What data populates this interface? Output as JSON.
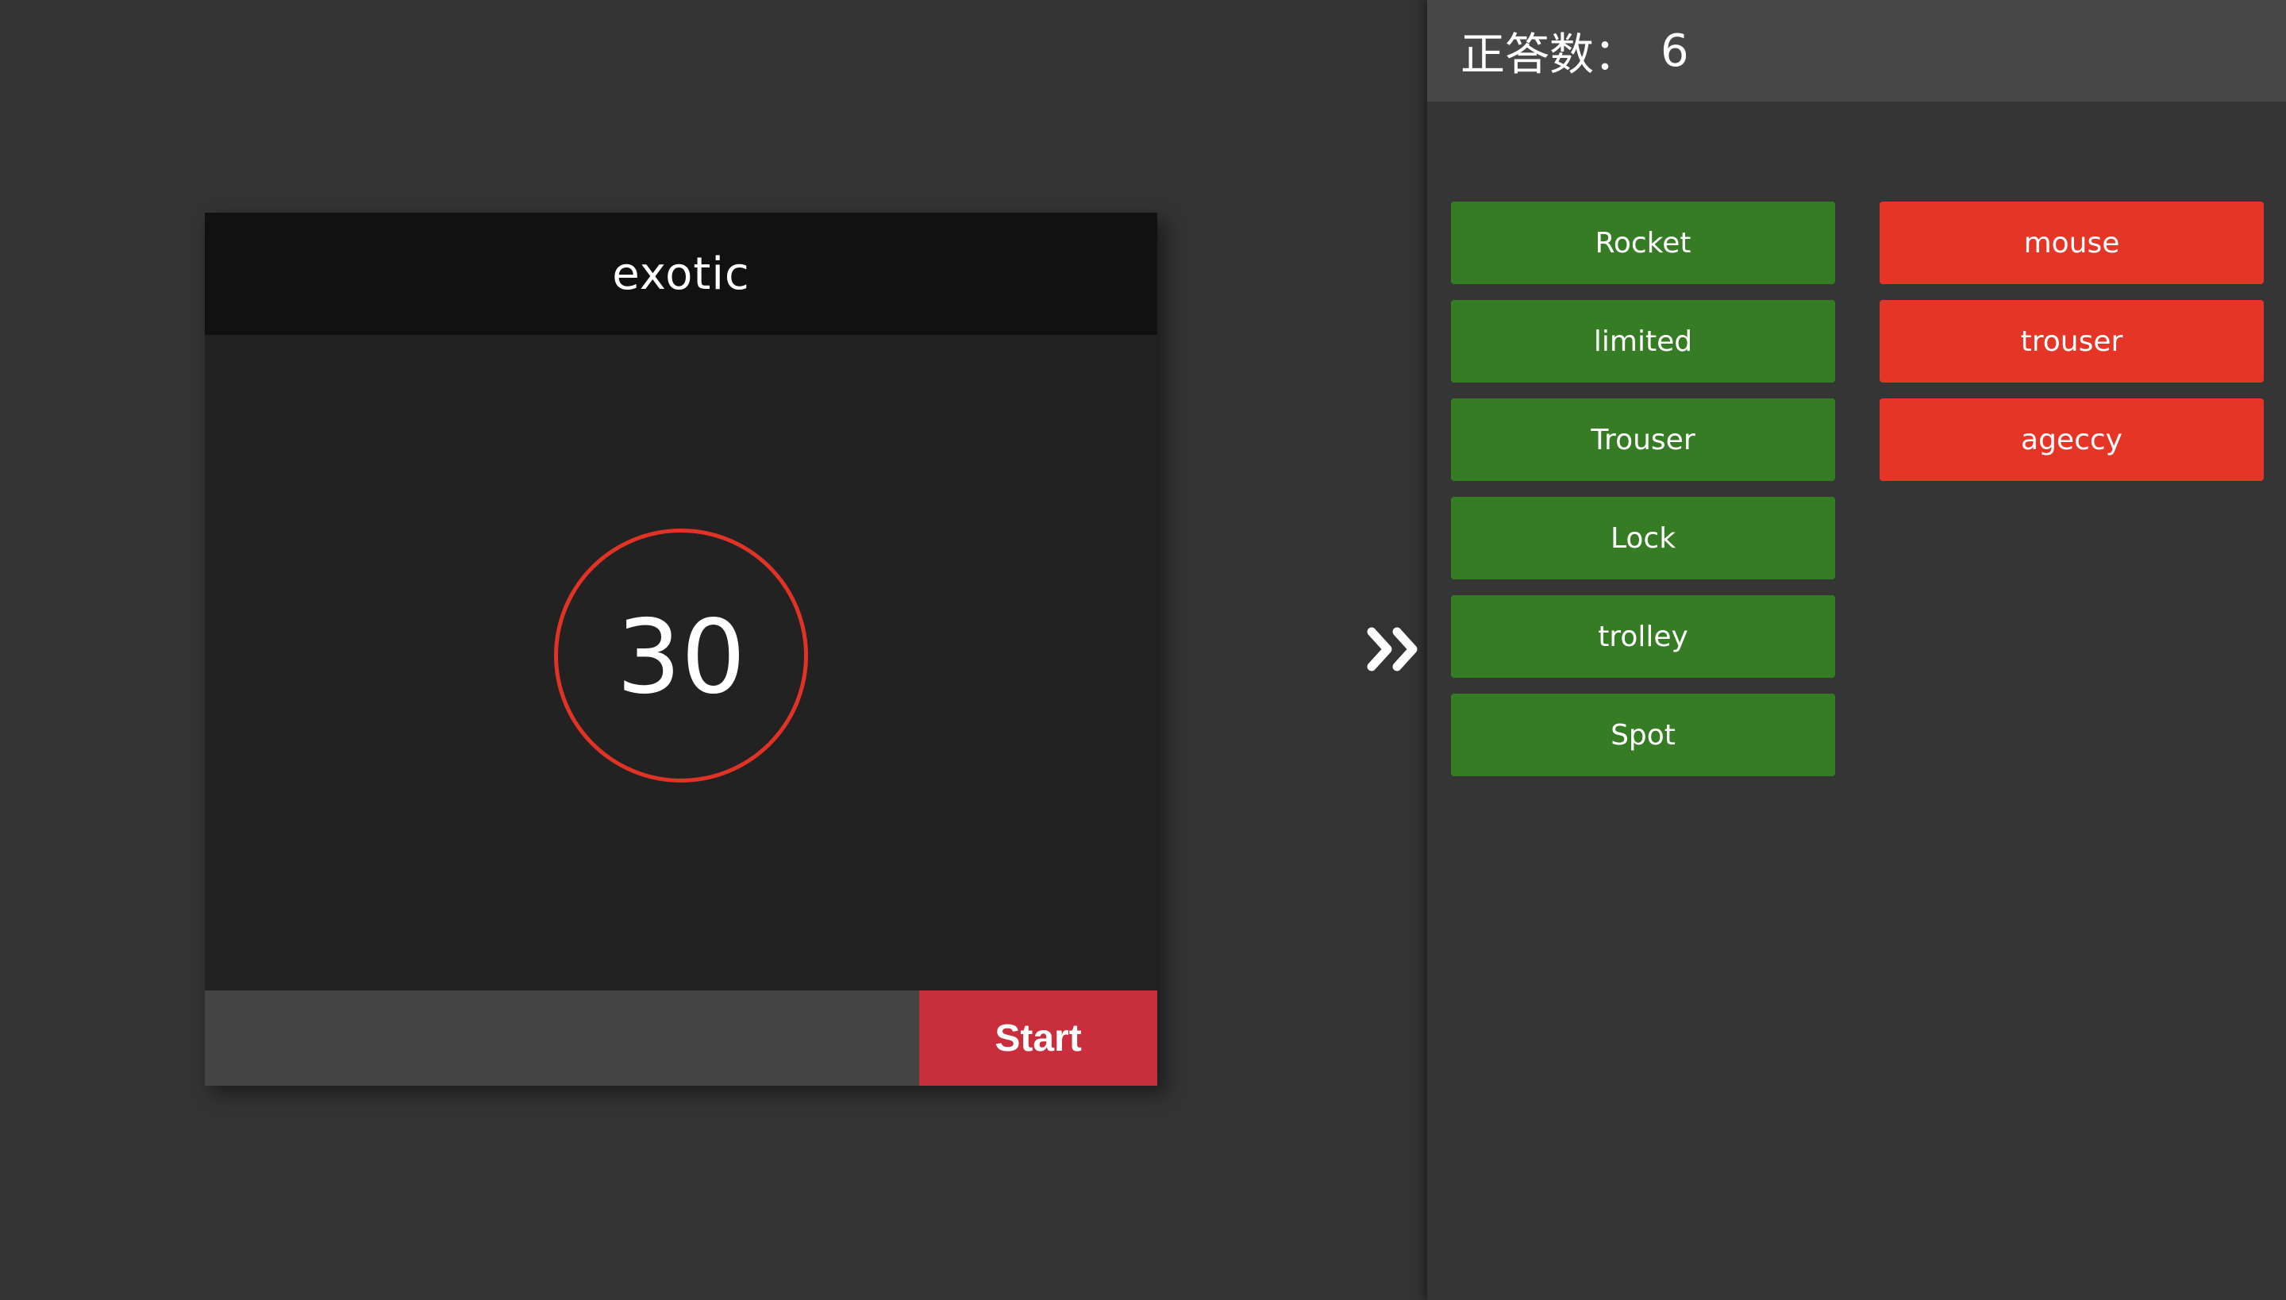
{
  "game": {
    "current_word": "exotic",
    "timer_value": "30",
    "input_value": "",
    "input_placeholder": "",
    "start_label": "Start"
  },
  "panel": {
    "score_label": "正答数：",
    "score_value": "6",
    "toggle_icon": "double-chevron-right-icon",
    "correct_words": [
      "Rocket",
      "limited",
      "Trouser",
      "Lock",
      "trolley",
      "Spot"
    ],
    "wrong_words": [
      "mouse",
      "trouser",
      "ageccy"
    ]
  },
  "colors": {
    "background": "#333333",
    "card": "#222222",
    "header": "#111111",
    "timer_ring": "#e03325",
    "start_button": "#c92e3d",
    "correct": "#367c24",
    "wrong": "#e43527",
    "score_bar": "#474747"
  }
}
